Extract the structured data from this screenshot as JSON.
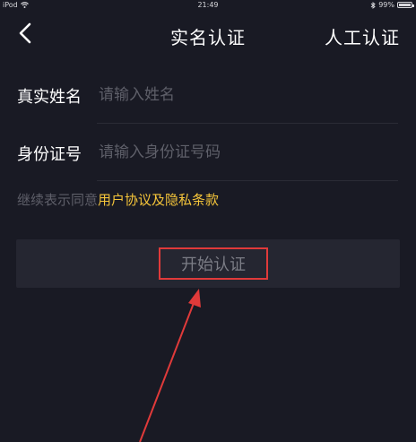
{
  "status_bar": {
    "device": "iPod",
    "time": "21:49",
    "battery": "99%",
    "battery_level": 0.99
  },
  "nav": {
    "title": "实名认证",
    "manual_label": "人工认证",
    "back_icon": "chevron-left-icon"
  },
  "form": {
    "name": {
      "label": "真实姓名",
      "placeholder": "请输入姓名",
      "value": ""
    },
    "id_number": {
      "label": "身份证号",
      "placeholder": "请输入身份证号码",
      "value": ""
    }
  },
  "agreement": {
    "prefix": "继续表示同意",
    "link": "用户协议及隐私条款"
  },
  "start_button": {
    "label": "开始认证"
  },
  "colors": {
    "background": "#191a24",
    "accent_link": "#f5c53a",
    "highlight_box": "#e03a3a",
    "annotation_arrow": "#e03a3a"
  }
}
